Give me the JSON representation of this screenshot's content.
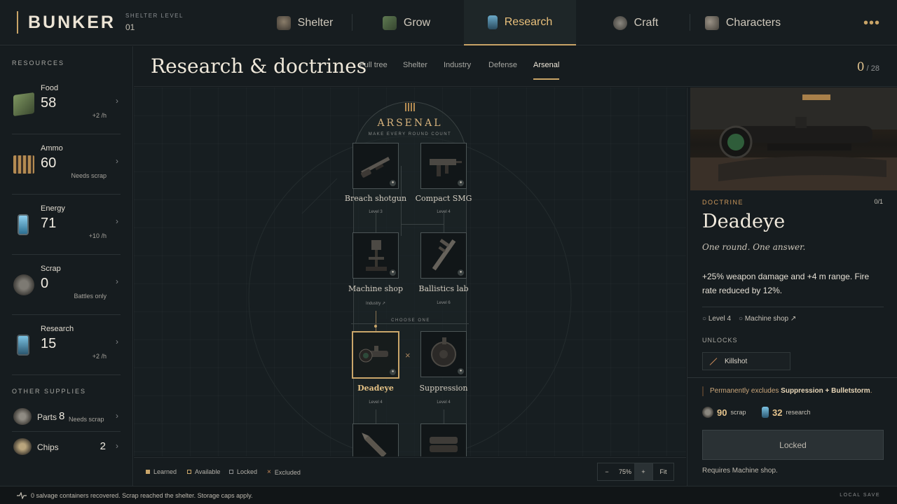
{
  "app": {
    "brand": "BUNKER",
    "shelter_level_label": "SHELTER LEVEL",
    "shelter_level_value": "01",
    "more_label": "•••"
  },
  "nav": [
    {
      "label": "Shelter",
      "icon": "shelter-icon"
    },
    {
      "label": "Grow",
      "icon": "crate-icon"
    },
    {
      "label": "Research",
      "icon": "research-canister-icon",
      "active": true
    },
    {
      "label": "Craft",
      "icon": "gears-icon"
    },
    {
      "label": "Characters",
      "icon": "people-icon"
    }
  ],
  "sidebar": {
    "resources_heading": "RESOURCES",
    "resources": [
      {
        "name": "Food",
        "value": "58",
        "sub": "+2 /h",
        "icon": "food-crate-icon"
      },
      {
        "name": "Ammo",
        "value": "60",
        "sub": "Needs scrap",
        "icon": "ammo-icon"
      },
      {
        "name": "Energy",
        "value": "71",
        "sub": "+10 /h",
        "icon": "battery-icon"
      },
      {
        "name": "Scrap",
        "value": "0",
        "sub": "Battles only",
        "icon": "scrap-icon"
      },
      {
        "name": "Research",
        "value": "15",
        "sub": "+2 /h",
        "icon": "research-canister-icon"
      }
    ],
    "supplies_heading": "OTHER SUPPLIES",
    "supplies": [
      {
        "name": "Parts",
        "value": "8",
        "sub": "Needs scrap",
        "icon": "parts-icon"
      },
      {
        "name": "Chips",
        "value": "2",
        "sub": "",
        "icon": "chips-icon"
      }
    ]
  },
  "main": {
    "title": "Research & doctrines",
    "tabs": [
      "Full tree",
      "Shelter",
      "Industry",
      "Defense",
      "Arsenal"
    ],
    "active_tab": "Arsenal",
    "progress_done": "0",
    "progress_total": "/ 28"
  },
  "tree": {
    "title": "ARSENAL",
    "subtitle": "MAKE EVERY ROUND COUNT",
    "choose_label": "CHOOSE ONE",
    "choose_sep": "×",
    "nodes": [
      {
        "name": "Breach shotgun",
        "level": "Level 3",
        "icon": "shotgun-icon"
      },
      {
        "name": "Compact SMG",
        "level": "Level 4",
        "icon": "smg-icon"
      },
      {
        "name": "Machine shop",
        "level": "Industry ↗",
        "icon": "drill-press-icon"
      },
      {
        "name": "Ballistics lab",
        "level": "Level 6",
        "icon": "caliper-icon"
      },
      {
        "name": "Deadeye",
        "level": "Level 4",
        "icon": "scope-icon",
        "selected": true
      },
      {
        "name": "Suppression",
        "level": "Level 4",
        "icon": "drum-mag-icon"
      },
      {
        "name": "",
        "level": "",
        "icon": "bullet-icon"
      },
      {
        "name": "",
        "level": "",
        "icon": "launcher-icon"
      }
    ]
  },
  "legend": {
    "learned": "Learned",
    "available": "Available",
    "locked": "Locked",
    "excluded": "Excluded"
  },
  "zoom": {
    "minus": "−",
    "value": "75%",
    "plus": "+",
    "fit": "Fit"
  },
  "detail": {
    "kind": "DOCTRINE",
    "count": "0/1",
    "title": "Deadeye",
    "tagline": "One round. One answer.",
    "description": "+25% weapon damage and +4 m range. Fire rate reduced by 12%.",
    "req_level": "Level 4",
    "req_building": "Machine shop ↗",
    "unlocks_label": "UNLOCKS",
    "unlock_item": "Killshot",
    "excludes_prefix": "Permanently excludes ",
    "excludes_items": "Suppression + Bulletstorm",
    "excludes_suffix": ".",
    "cost_scrap_value": "90",
    "cost_scrap_label": "scrap",
    "cost_research_value": "32",
    "cost_research_label": "research",
    "button_label": "Locked",
    "requires_note": "Requires Machine shop."
  },
  "status": {
    "text": "0 salvage containers recovered. Scrap reached the shelter. Storage caps apply.",
    "save": "LOCAL SAVE"
  },
  "colors": {
    "accent": "#c9a467",
    "bg": "#13181b",
    "excluded": "#c98a5a"
  }
}
